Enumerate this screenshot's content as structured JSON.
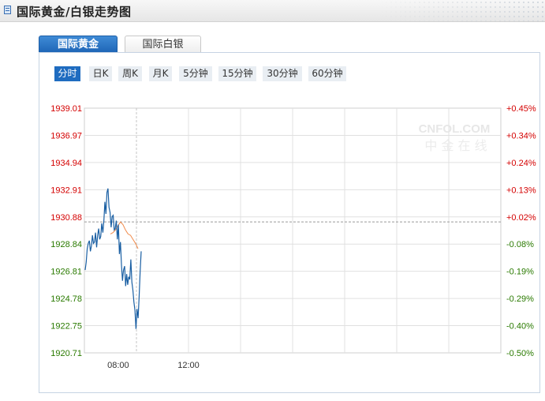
{
  "header": {
    "title": "国际黄金/白银走势图"
  },
  "tabs": [
    {
      "label": "国际黄金",
      "active": true
    },
    {
      "label": "国际白银",
      "active": false
    }
  ],
  "periods": [
    {
      "label": "分时",
      "active": true
    },
    {
      "label": "日K",
      "active": false
    },
    {
      "label": "周K",
      "active": false
    },
    {
      "label": "月K",
      "active": false
    },
    {
      "label": "5分钟",
      "active": false
    },
    {
      "label": "15分钟",
      "active": false
    },
    {
      "label": "30分钟",
      "active": false
    },
    {
      "label": "60分钟",
      "active": false
    }
  ],
  "watermark": {
    "line1": "CNFOL.COM",
    "line2": "中 金 在 线"
  },
  "colors": {
    "up": "#d40000",
    "down": "#2a7a00",
    "price_line": "#1a5fa3",
    "avg_line": "#f08a4b",
    "grid": "#e0e0e0",
    "accent": "#1f6cc0"
  },
  "chart_data": {
    "type": "line",
    "title": "",
    "y_labels": [
      "1939.01",
      "1936.97",
      "1934.94",
      "1932.91",
      "1930.88",
      "1928.84",
      "1926.81",
      "1924.78",
      "1922.75",
      "1920.71"
    ],
    "pct_labels": [
      "+0.45%",
      "+0.34%",
      "+0.24%",
      "+0.13%",
      "+0.02%",
      "-0.08%",
      "-0.19%",
      "-0.29%",
      "-0.40%",
      "-0.50%"
    ],
    "x_labels": [
      "08:00",
      "12:00"
    ],
    "reference_price": 1930.5,
    "ylim": [
      1920.71,
      1939.01
    ],
    "series": [
      {
        "values": [
          1926.9,
          1927.5,
          1928.5,
          1928.9,
          1929.1,
          1928.3,
          1928.7,
          1929.5,
          1928.9,
          1929.0,
          1929.7,
          1928.6,
          1929.5,
          1930.0,
          1929.2,
          1929.4,
          1930.4,
          1929.7,
          1930.6,
          1932.0,
          1931.1,
          1932.7,
          1933.0,
          1931.6,
          1931.2,
          1930.1,
          1930.9,
          1931.0,
          1929.9,
          1930.0,
          1930.6,
          1929.2,
          1930.3,
          1928.1,
          1929.0,
          1927.3,
          1926.1,
          1926.9,
          1927.2,
          1925.7,
          1926.6,
          1925.8,
          1926.4,
          1926.2,
          1927.7,
          1926.0,
          1925.4,
          1924.5,
          1923.9,
          1922.5,
          1924.0,
          1923.3,
          1924.9,
          1926.8,
          1928.3
        ]
      },
      {
        "values": [
          1929.6,
          1929.7,
          1929.9,
          1930.2,
          1930.5,
          1930.3,
          1929.9,
          1929.6,
          1929.5,
          1929.2,
          1928.9,
          1928.5
        ]
      }
    ]
  }
}
